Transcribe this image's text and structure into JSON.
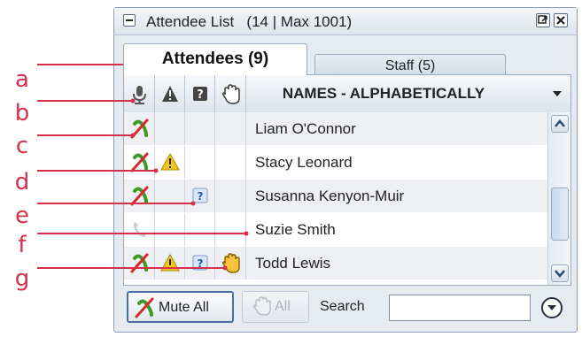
{
  "callouts": [
    "a",
    "b",
    "c",
    "d",
    "e",
    "f",
    "g"
  ],
  "panel": {
    "title": "Attendee List",
    "count": "(14 | Max 1001)"
  },
  "tabs": [
    {
      "label": "Attendees (9)",
      "active": true
    },
    {
      "label": "Staff (5)",
      "active": false
    }
  ],
  "columns": {
    "icons": [
      "microphone-icon",
      "warning-icon",
      "question-icon",
      "raise-hand-icon"
    ],
    "names_header": "NAMES - ALPHABETICALLY"
  },
  "attendees": [
    {
      "name": "Liam O'Connor",
      "muted": true,
      "warning": false,
      "question": false,
      "hand": false
    },
    {
      "name": "Stacy Leonard",
      "muted": true,
      "warning": true,
      "question": false,
      "hand": false
    },
    {
      "name": "Susanna Kenyon-Muir",
      "muted": true,
      "warning": false,
      "question": true,
      "hand": false
    },
    {
      "name": "Suzie Smith",
      "muted": false,
      "phone": true,
      "warning": false,
      "question": false,
      "hand": false
    },
    {
      "name": "Todd Lewis",
      "muted": true,
      "warning": true,
      "question": true,
      "hand": true
    }
  ],
  "footer": {
    "mute_all": "Mute All",
    "all": "All",
    "search_label": "Search",
    "search_value": ""
  },
  "colors": {
    "callout": "#d6304a",
    "mute_slash": "#d42a2a",
    "mic_green": "#3d9a2a",
    "warning": "#f3c61a",
    "question": "#1f57b0",
    "hand": "#e0a01a"
  }
}
